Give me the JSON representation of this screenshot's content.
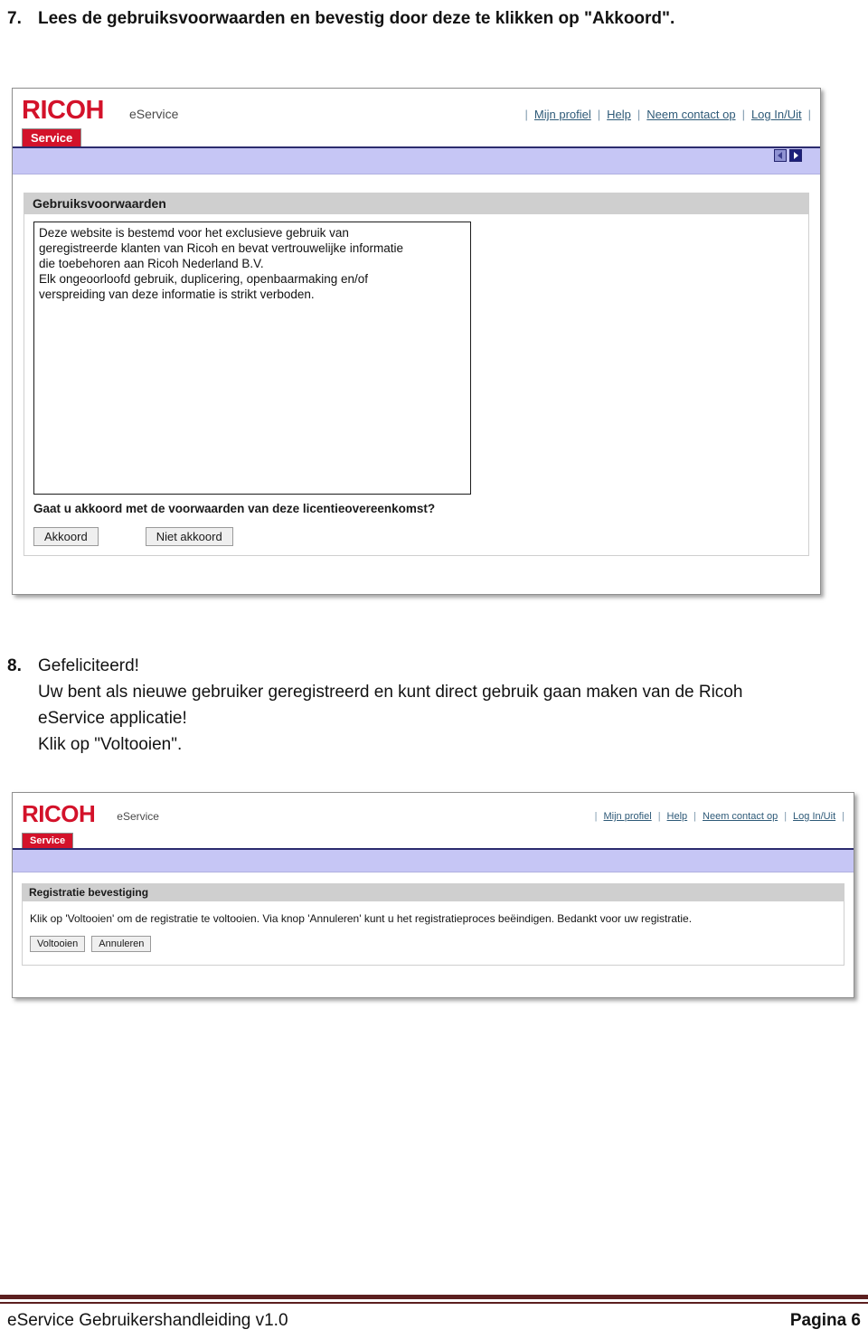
{
  "document": {
    "steps": [
      {
        "number": "7.",
        "lines": [
          "Lees de gebruiksvoorwaarden en bevestig door deze te klikken op \"Akkoord\"."
        ]
      },
      {
        "number": "8.",
        "lines": [
          "Gefeliciteerd!",
          "Uw bent als nieuwe gebruiker geregistreerd en kunt direct gebruik gaan maken van de Ricoh",
          "eService applicatie!",
          "Klik op \"Voltooien\"."
        ]
      }
    ],
    "footer": {
      "left": "eService Gebruikershandleiding v1.0",
      "right": "Pagina 6"
    }
  },
  "screenshot1": {
    "header": {
      "logo": "RICOH",
      "product": "eService",
      "nav": {
        "separator": "|",
        "links": [
          "Mijn profiel",
          "Help",
          "Neem contact op",
          "Log In/Uit"
        ]
      },
      "pager": {
        "prev_label": "prev-arrow-icon",
        "next_label": "next-arrow-icon"
      },
      "tab": "Service"
    },
    "panel": {
      "title": "Gebruiksvoorwaarden",
      "terms": [
        "Deze website is bestemd voor het exclusieve gebruik van",
        "geregistreerde klanten van Ricoh en bevat vertrouwelijke informatie",
        "die toebehoren aan Ricoh Nederland B.V.",
        "Elk ongeoorloofd gebruik, duplicering, openbaarmaking en/of",
        "verspreiding van deze informatie is strikt verboden."
      ],
      "question": "Gaat u akkoord met de voorwaarden van deze licentieovereenkomst?",
      "buttons": {
        "agree": "Akkoord",
        "disagree": "Niet akkoord"
      }
    }
  },
  "screenshot2": {
    "header": {
      "logo": "RICOH",
      "product": "eService",
      "nav": {
        "separator": "|",
        "links": [
          "Mijn profiel",
          "Help",
          "Neem contact op",
          "Log In/Uit"
        ]
      },
      "tab": "Service"
    },
    "panel": {
      "title": "Registratie bevestiging",
      "text": "Klik op 'Voltooien' om de registratie te voltooien. Via knop 'Annuleren' kunt u het registratieproces beëindigen. Bedankt voor uw registratie.",
      "buttons": {
        "finish": "Voltooien",
        "cancel": "Annuleren"
      }
    }
  },
  "colors": {
    "brand_red": "#d3122a",
    "nav_blue": "#2e5a78",
    "lavender_bar": "#c6c6f5",
    "navy_rule": "#2c2c6e",
    "panel_header_gray": "#cfcfcf",
    "footer_rule": "#5c1f1f"
  }
}
